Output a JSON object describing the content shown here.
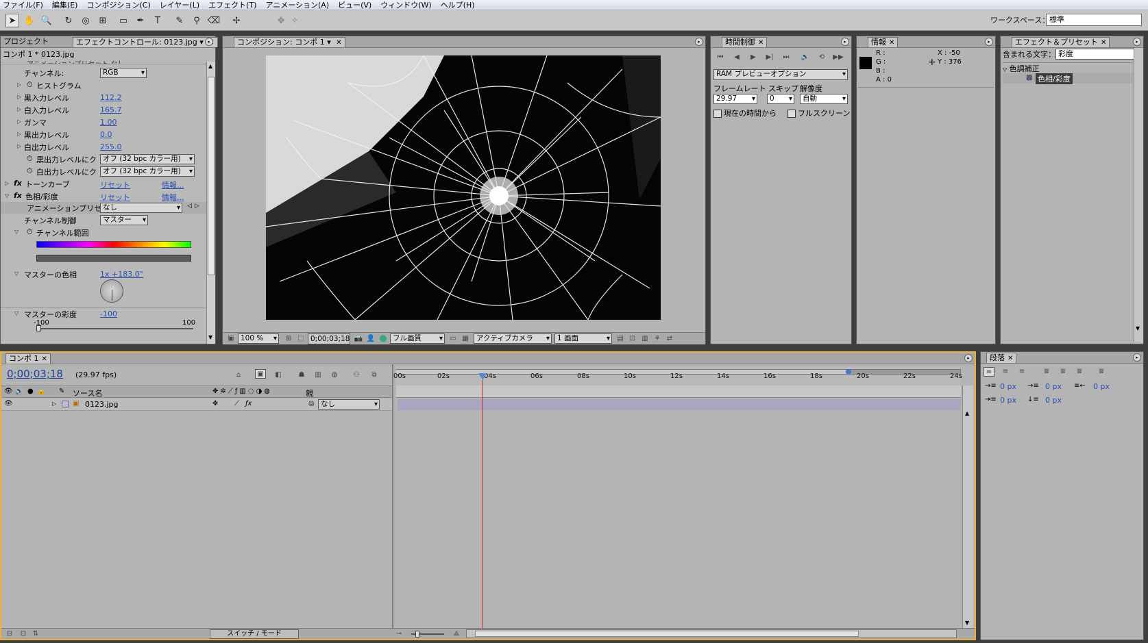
{
  "menubar": [
    "ファイル(F)",
    "編集(E)",
    "コンポジション(C)",
    "レイヤー(L)",
    "エフェクト(T)",
    "アニメーション(A)",
    "ビュー(V)",
    "ウィンドウ(W)",
    "ヘルプ(H)"
  ],
  "workspace": {
    "label": "ワークスペース：",
    "value": "標準"
  },
  "left_panel": {
    "tab_project": "プロジェクト",
    "tab_effect": "エフェクトコントロール: 0123.jpg",
    "subtitle": "コンポ 1 * 0123.jpg",
    "cut_row": "アニメーションプリセット   なし",
    "channel_label": "チャンネル:",
    "channel_value": "RGB",
    "histogram": "ヒストグラム",
    "levels": [
      {
        "label": "黒入力レベル",
        "value": "112.2"
      },
      {
        "label": "白入力レベル",
        "value": "165.7"
      },
      {
        "label": "ガンマ",
        "value": "1.00"
      },
      {
        "label": "黒出力レベル",
        "value": "0.0"
      },
      {
        "label": "白出力レベル",
        "value": "255.0"
      }
    ],
    "clip_black_label": "黒出力レベルにク",
    "clip_black_value": "オフ (32 bpc カラー用)",
    "clip_white_label": "白出力レベルにク",
    "clip_white_value": "オフ (32 bpc カラー用)",
    "tone_curve": "トーンカーブ",
    "hue_sat": "色相/彩度",
    "reset": "リセット",
    "info": "情報...",
    "anim_preset_label": "アニメーションプリセット",
    "anim_preset_value": "なし",
    "channel_control_label": "チャンネル制御",
    "channel_control_value": "マスター",
    "channel_range": "チャンネル範囲",
    "master_hue_label": "マスターの色相",
    "master_hue_value": "1x +183.0°",
    "master_sat_label": "マスターの彩度",
    "master_sat_value": "-100",
    "slider_min": "-100",
    "slider_max": "100"
  },
  "comp_panel": {
    "tab": "コンポジション: コンポ 1",
    "zoom": "100 %",
    "time": "0;00;03;18",
    "quality": "フル画質",
    "camera": "アクティブカメラ",
    "views": "1 画面"
  },
  "time_control": {
    "tab": "時間制御",
    "ram_preview": "RAM プレビューオプション",
    "framerate_label": "フレームレート",
    "skip_label": "スキップ",
    "resolution_label": "解像度",
    "framerate_value": "29.97",
    "skip_value": "0",
    "resolution_value": "自動",
    "from_current": "現在の時間から",
    "fullscreen": "フルスクリーン"
  },
  "info_panel": {
    "tab": "情報",
    "r": "R :",
    "g": "G :",
    "b": "B :",
    "a": "A : 0",
    "x": "X : -50",
    "y": "Y : 376"
  },
  "effects_panel": {
    "tab": "エフェクト＆プリセット",
    "search_label": "含まれる文字：",
    "search_value": "彩度",
    "category": "色調補正",
    "item": "色相/彩度"
  },
  "timeline": {
    "tab": "コンポ 1",
    "timecode": "0;00;03;18",
    "fps": "(29.97 fps)",
    "col_source": "ソース名",
    "col_parent": "親",
    "layer_name": "0123.jpg",
    "layer_parent": "なし",
    "switch_mode": "スイッチ / モード",
    "ruler": [
      "00s",
      "02s",
      "04s",
      "06s",
      "08s",
      "10s",
      "12s",
      "14s",
      "16s",
      "18s",
      "20s",
      "22s",
      "24s"
    ]
  },
  "paragraph_panel": {
    "tab": "段落",
    "px": "0 px"
  },
  "colors": {
    "timeline_highlight": "#e9b13a",
    "link_blue": "#2a4fb3",
    "playhead": "#e02020",
    "layer_bar": "#a9a6c2"
  }
}
